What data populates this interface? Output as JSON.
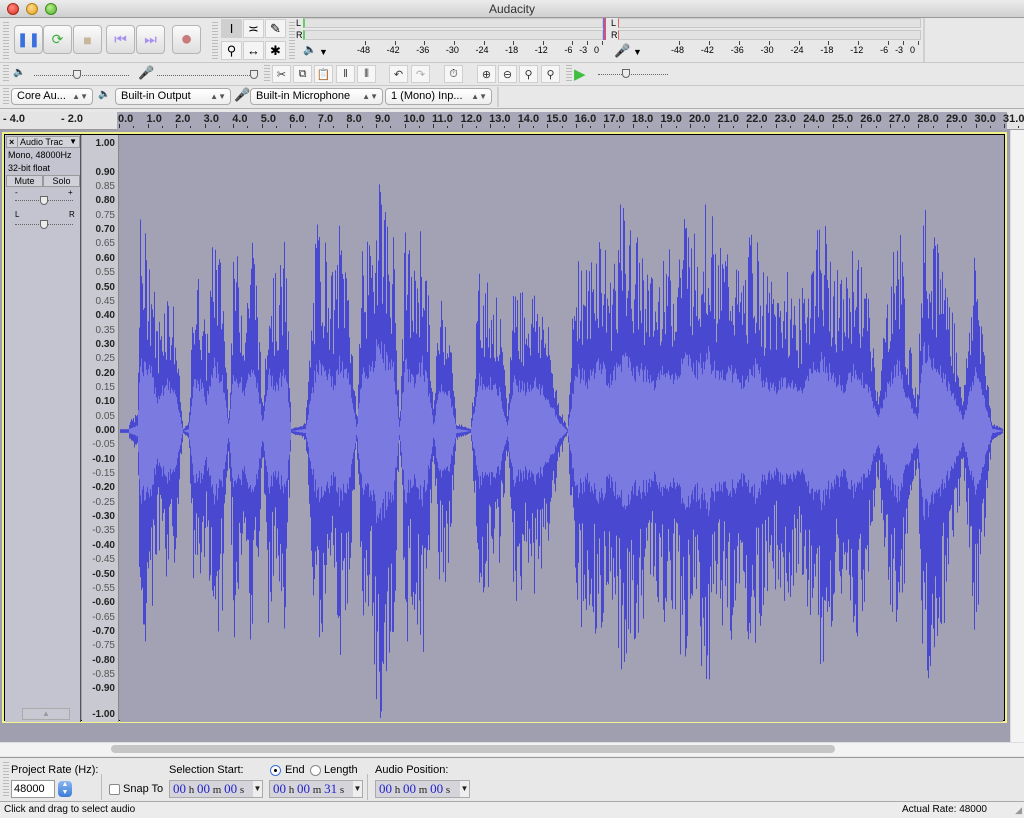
{
  "window": {
    "title": "Audacity"
  },
  "transport": {
    "buttons": [
      {
        "name": "pause-button",
        "icon": "pause-icon",
        "glyph": "❚❚",
        "color": "#3a6fe0"
      },
      {
        "name": "play-button",
        "icon": "loop-play-icon",
        "glyph": "⟳",
        "color": "#3fae3a"
      },
      {
        "name": "stop-button",
        "icon": "stop-icon",
        "glyph": "■",
        "color": "#c7b79a"
      },
      {
        "name": "skip-start-button",
        "icon": "skip-to-start-icon",
        "glyph": "⏮",
        "color": "#a890f0"
      },
      {
        "name": "skip-end-button",
        "icon": "skip-to-end-icon",
        "glyph": "⏭",
        "color": "#a890f0"
      },
      {
        "name": "record-button",
        "icon": "record-icon",
        "glyph": "●",
        "color": "#c97a7a"
      }
    ]
  },
  "tools": [
    {
      "name": "selection-tool",
      "icon": "i-beam-icon",
      "glyph": "I",
      "selected": true
    },
    {
      "name": "envelope-tool",
      "icon": "envelope-icon",
      "glyph": "≍",
      "selected": false
    },
    {
      "name": "draw-tool",
      "icon": "pencil-icon",
      "glyph": "✎",
      "selected": false
    },
    {
      "name": "zoom-tool",
      "icon": "magnifier-icon",
      "glyph": "⚲",
      "selected": false
    },
    {
      "name": "timeshift-tool",
      "icon": "double-arrow-icon",
      "glyph": "↔",
      "selected": false
    },
    {
      "name": "multi-tool",
      "icon": "asterisk-icon",
      "glyph": "✱",
      "selected": false
    }
  ],
  "meters": {
    "playback": {
      "left_label": "L",
      "right_label": "R"
    },
    "record": {
      "left_label": "L",
      "right_label": "R"
    },
    "scale": [
      "-48",
      "-42",
      "-36",
      "-30",
      "-24",
      "-18",
      "-12",
      "-6",
      "-3",
      "0"
    ]
  },
  "mixer": {
    "output_volume": 0.45,
    "input_volume": 1.0
  },
  "edit_toolbar": [
    {
      "name": "cut-button",
      "icon": "scissors-icon",
      "glyph": "✂"
    },
    {
      "name": "copy-button",
      "icon": "copy-icon",
      "glyph": "⧉"
    },
    {
      "name": "paste-button",
      "icon": "paste-icon",
      "glyph": "📋"
    },
    {
      "name": "trim-button",
      "icon": "trim-icon",
      "glyph": "‖"
    },
    {
      "name": "silence-button",
      "icon": "silence-icon",
      "glyph": "⦀"
    },
    {
      "name": "undo-button",
      "icon": "undo-icon",
      "glyph": "↶"
    },
    {
      "name": "redo-button",
      "icon": "redo-icon",
      "glyph": "↷"
    },
    {
      "name": "sync-lock-button",
      "icon": "stopwatch-icon",
      "glyph": "⏱"
    },
    {
      "name": "zoom-in-button",
      "icon": "zoom-in-icon",
      "glyph": "⊕"
    },
    {
      "name": "zoom-out-button",
      "icon": "zoom-out-icon",
      "glyph": "⊖"
    },
    {
      "name": "fit-selection-button",
      "icon": "fit-selection-icon",
      "glyph": "⚲"
    },
    {
      "name": "fit-project-button",
      "icon": "fit-project-icon",
      "glyph": "⚲"
    }
  ],
  "play_at_speed": {
    "speed": 0.4
  },
  "devices": {
    "host": "Core Au...",
    "output": "Built-in Output",
    "input": "Built-in Microphone",
    "channels": "1 (Mono) Inp..."
  },
  "timeline": {
    "labels_before": [
      "- 4.0",
      "- 2.0"
    ],
    "labels": [
      "0.0",
      "1.0",
      "2.0",
      "3.0",
      "4.0",
      "5.0",
      "6.0",
      "7.0",
      "8.0",
      "9.0",
      "10.0",
      "11.0",
      "12.0",
      "13.0",
      "14.0",
      "15.0",
      "16.0",
      "17.0",
      "18.0",
      "19.0",
      "20.0",
      "21.0",
      "22.0",
      "23.0",
      "24.0",
      "25.0",
      "26.0",
      "27.0",
      "28.0",
      "29.0",
      "30.0",
      "31.0"
    ]
  },
  "track": {
    "name": "Audio Trac",
    "format": "Mono, 48000Hz",
    "bit_depth": "32-bit float",
    "mute_label": "Mute",
    "solo_label": "Solo",
    "gain_minus": "-",
    "gain_plus": "+",
    "pan_left": "L",
    "pan_right": "R",
    "gain": 0.5,
    "pan": 0.5,
    "amplitude_scale": [
      "1.00",
      "0.90",
      "0.85",
      "0.80",
      "0.75",
      "0.70",
      "0.65",
      "0.60",
      "0.55",
      "0.50",
      "0.45",
      "0.40",
      "0.35",
      "0.30",
      "0.25",
      "0.20",
      "0.15",
      "0.10",
      "0.05",
      "0.00",
      "-0.05",
      "-0.10",
      "-0.15",
      "-0.20",
      "-0.25",
      "-0.30",
      "-0.35",
      "-0.40",
      "-0.45",
      "-0.50",
      "-0.55",
      "-0.60",
      "-0.65",
      "-0.70",
      "-0.75",
      "-0.80",
      "-0.85",
      "-0.90",
      "-1.00"
    ],
    "waveform_color": "#4848d0",
    "waveform_rms_color": "#7a7ae0",
    "duration_seconds": 31,
    "peaks": [
      [
        0.3,
        0.02
      ],
      [
        0.6,
        0.05
      ],
      [
        0.7,
        0.6
      ],
      [
        1.1,
        0.5
      ],
      [
        1.3,
        0.3
      ],
      [
        1.6,
        0.43
      ],
      [
        1.9,
        0.35
      ],
      [
        2.2,
        0.0
      ],
      [
        2.4,
        0.02
      ],
      [
        2.6,
        0.48
      ],
      [
        2.9,
        0.4
      ],
      [
        3.0,
        0.25
      ],
      [
        3.3,
        0.6
      ],
      [
        3.6,
        0.45
      ],
      [
        3.8,
        0.05
      ],
      [
        4.0,
        0.55
      ],
      [
        4.4,
        0.35
      ],
      [
        4.6,
        0.62
      ],
      [
        4.8,
        0.45
      ],
      [
        5.0,
        0.05
      ],
      [
        5.2,
        0.5
      ],
      [
        5.5,
        0.42
      ],
      [
        5.8,
        0.55
      ],
      [
        6.0,
        0.0
      ],
      [
        6.5,
        0.02
      ],
      [
        6.9,
        0.6
      ],
      [
        7.2,
        0.55
      ],
      [
        7.5,
        0.42
      ],
      [
        7.7,
        0.6
      ],
      [
        8.0,
        0.48
      ],
      [
        8.3,
        0.02
      ],
      [
        8.5,
        0.58
      ],
      [
        8.8,
        0.5
      ],
      [
        9.1,
        0.85
      ],
      [
        9.3,
        0.65
      ],
      [
        9.6,
        0.55
      ],
      [
        9.8,
        0.02
      ],
      [
        10.0,
        0.58
      ],
      [
        10.3,
        0.45
      ],
      [
        10.6,
        0.62
      ],
      [
        10.8,
        0.4
      ],
      [
        11.0,
        0.05
      ],
      [
        11.2,
        0.4
      ],
      [
        11.5,
        0.38
      ],
      [
        11.8,
        0.02
      ],
      [
        12.3,
        0.0
      ],
      [
        12.6,
        0.45
      ],
      [
        13.0,
        0.42
      ],
      [
        13.3,
        0.35
      ],
      [
        13.6,
        0.05
      ],
      [
        13.8,
        0.46
      ],
      [
        14.2,
        0.38
      ],
      [
        14.6,
        0.42
      ],
      [
        15.0,
        0.3
      ],
      [
        15.4,
        0.08
      ],
      [
        15.7,
        0.0
      ],
      [
        16.0,
        0.55
      ],
      [
        16.4,
        0.45
      ],
      [
        16.8,
        0.6
      ],
      [
        17.2,
        0.45
      ],
      [
        17.6,
        0.65
      ],
      [
        18.0,
        0.55
      ],
      [
        18.4,
        0.52
      ],
      [
        18.8,
        0.4
      ],
      [
        19.1,
        0.58
      ],
      [
        19.4,
        0.45
      ],
      [
        19.8,
        0.65
      ],
      [
        20.2,
        0.55
      ],
      [
        20.6,
        0.68
      ],
      [
        21.0,
        0.5
      ],
      [
        21.4,
        0.55
      ],
      [
        21.8,
        0.42
      ],
      [
        22.2,
        0.6
      ],
      [
        22.6,
        0.45
      ],
      [
        23.0,
        0.4
      ],
      [
        23.4,
        0.45
      ],
      [
        23.8,
        0.35
      ],
      [
        24.2,
        0.5
      ],
      [
        24.6,
        0.62
      ],
      [
        25.0,
        0.5
      ],
      [
        25.4,
        0.4
      ],
      [
        25.8,
        0.55
      ],
      [
        26.2,
        0.42
      ],
      [
        26.6,
        0.12
      ],
      [
        27.0,
        0.45
      ],
      [
        27.4,
        0.6
      ],
      [
        27.6,
        0.3
      ],
      [
        28.0,
        0.1
      ],
      [
        28.2,
        0.78
      ],
      [
        28.5,
        0.6
      ],
      [
        28.9,
        0.5
      ],
      [
        29.2,
        0.35
      ],
      [
        29.6,
        0.1
      ],
      [
        30.0,
        0.55
      ],
      [
        30.3,
        0.3
      ],
      [
        30.6,
        0.02
      ],
      [
        31.0,
        0.0
      ]
    ],
    "collapse_button": "▲"
  },
  "selection_toolbar": {
    "project_rate_label": "Project Rate (Hz):",
    "project_rate_value": "48000",
    "snap_to_label": "Snap To",
    "snap_to_checked": false,
    "selection_start_label": "Selection Start:",
    "end_label": "End",
    "length_label": "Length",
    "end_selected": true,
    "audio_position_label": "Audio Position:",
    "selection_start": {
      "h": "00",
      "m": "00",
      "s": "00"
    },
    "selection_end": {
      "h": "00",
      "m": "00",
      "s": "31"
    },
    "audio_position": {
      "h": "00",
      "m": "00",
      "s": "00"
    },
    "unit_h": "h",
    "unit_m": "m",
    "unit_s": "s"
  },
  "status": {
    "message": "Click and drag to select audio",
    "actual_rate": "Actual Rate: 48000"
  }
}
